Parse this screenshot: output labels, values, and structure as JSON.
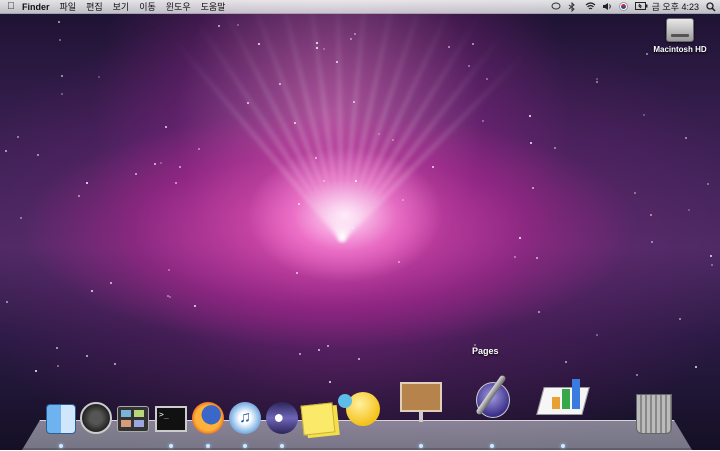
{
  "menubar": {
    "apple_icon": "apple-icon",
    "app_name": "Finder",
    "menus": [
      "파일",
      "편집",
      "보기",
      "이동",
      "윈도우",
      "도움말"
    ],
    "status_icons": [
      "spotlight-bubble-icon",
      "bluetooth-icon",
      "wifi-icon",
      "volume-icon",
      "korean-input-icon",
      "battery-icon"
    ],
    "clock": "금 오후 4:23"
  },
  "desktop": {
    "hd_label": "Macintosh HD"
  },
  "dock": {
    "tooltip": "Pages",
    "items": [
      {
        "name": "finder",
        "running": true
      },
      {
        "name": "dashboard",
        "running": false
      },
      {
        "name": "expose",
        "running": false
      },
      {
        "name": "terminal",
        "running": true
      },
      {
        "name": "firefox",
        "running": true
      },
      {
        "name": "itunes",
        "running": true
      },
      {
        "name": "eclipse",
        "running": true
      },
      {
        "name": "stickies",
        "running": false
      },
      {
        "name": "adium",
        "running": false
      },
      {
        "name": "keynote",
        "running": true
      },
      {
        "name": "pages",
        "running": true
      },
      {
        "name": "numbers",
        "running": true
      },
      {
        "name": "trash",
        "running": false
      }
    ]
  },
  "colors": {
    "wallpaper_core": "#ff8fe0",
    "wallpaper_dark": "#1b1230",
    "menubar": "#ececef"
  }
}
